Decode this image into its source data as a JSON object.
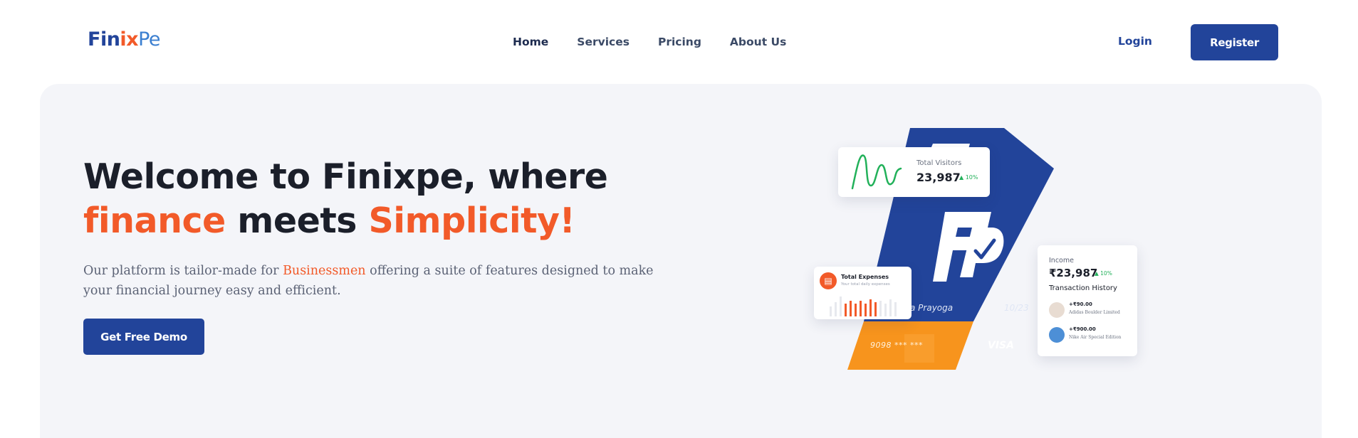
{
  "brand": {
    "part1": "Fin",
    "part2": "ix",
    "part3": "Pe"
  },
  "nav": {
    "items": [
      {
        "label": "Home"
      },
      {
        "label": "Services"
      },
      {
        "label": "Pricing"
      },
      {
        "label": "About Us"
      }
    ],
    "login": "Login",
    "register": "Register"
  },
  "hero": {
    "line1": "Welcome to Finixpe, where",
    "word_finance": "finance",
    "word_meets": " meets ",
    "word_simplicity": "Simplicity!",
    "desc_before": "Our platform is tailor-made for ",
    "desc_highlight": "Businessmen",
    "desc_after": " offering a suite of features designed to make your financial journey easy and efficient.",
    "cta": "Get Free Demo"
  },
  "illustration": {
    "visitors": {
      "label": "Total Visitors",
      "value": "23,987",
      "change": "10%"
    },
    "expenses": {
      "title": "Total Expenses",
      "subtitle": "Your total daily expenses"
    },
    "income": {
      "label": "Income",
      "value": "₹23,987",
      "change": "10%",
      "history_title": "Transaction History",
      "transactions": [
        {
          "amount": "+₹90.00",
          "name": "Adidas Boulder Limited"
        },
        {
          "amount": "+₹900.00",
          "name": "Nike Air Special Edition"
        }
      ]
    },
    "card": {
      "holder": "a Prayoga",
      "expiry": "10/23",
      "number": "9098 *** ***",
      "network": "VISA"
    }
  },
  "colors": {
    "primary": "#22449a",
    "accent": "#f25a29",
    "orange": "#f7941d",
    "success": "#22b15a"
  }
}
